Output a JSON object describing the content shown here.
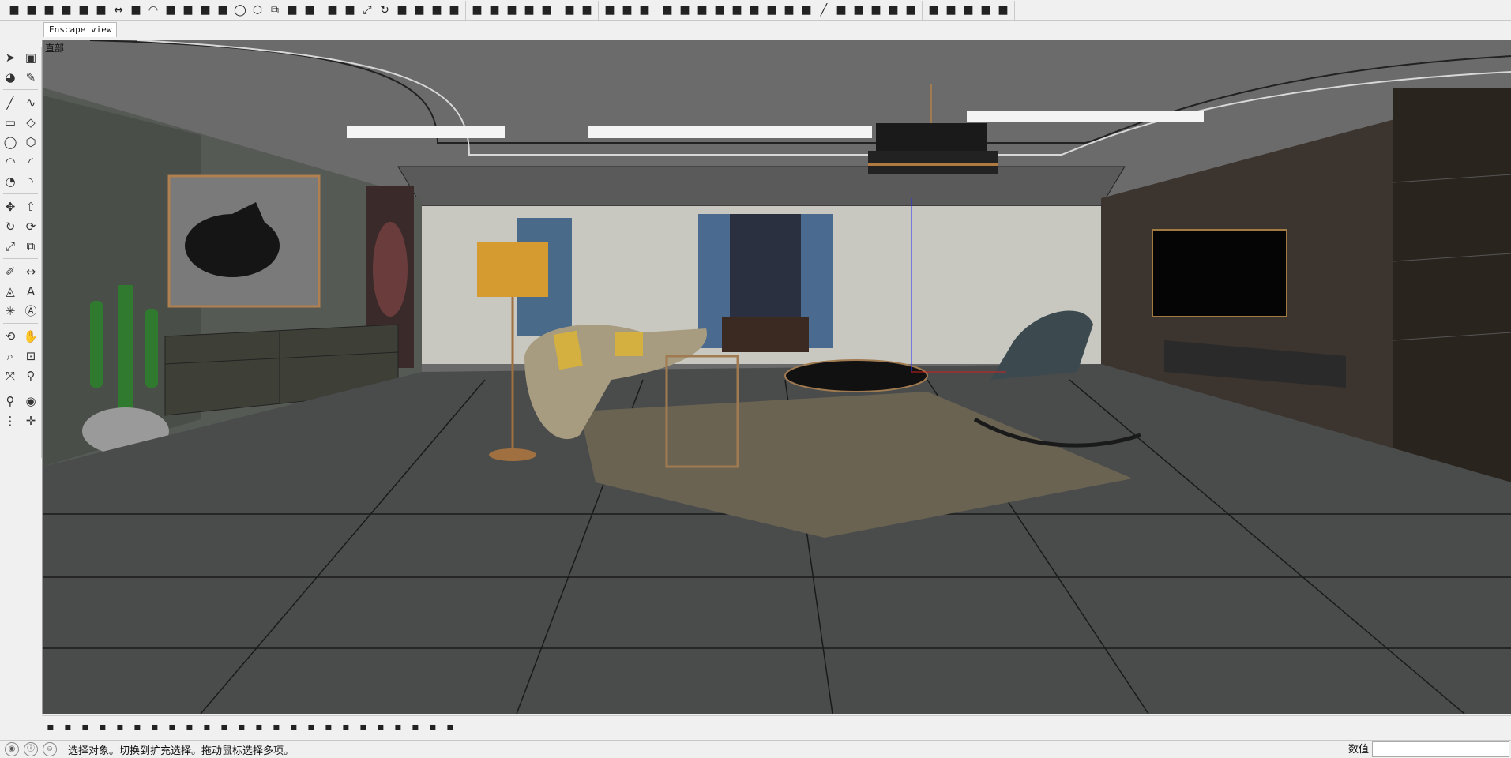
{
  "tab": {
    "label": "Enscape view"
  },
  "viewport": {
    "label": "直部"
  },
  "status": {
    "message": "选择对象。切换到扩充选择。拖动鼠标选择多项。",
    "measure_label": "数值",
    "measure_value": ""
  },
  "top_toolbar": {
    "groups": [
      [
        "layers-icon",
        "table-icon",
        "curve-icon",
        "bars-icon",
        "plugin-icon",
        "ruler-icon",
        "dimension-icon",
        "pencil-icon",
        "arc-icon",
        "bezier-icon",
        "wave-icon",
        "spiral-icon",
        "rectangle-icon",
        "circle-icon",
        "polygon-icon",
        "offset-icon",
        "shape-icon",
        "grid-icon"
      ],
      [
        "push-icon",
        "follow-icon",
        "scale-icon",
        "rotate-icon",
        "flip-icon",
        "mirror-icon",
        "array-icon",
        "door-icon"
      ],
      [
        "triangle-icon",
        "dots-icon",
        "page-icon",
        "pen-icon",
        "brush-icon"
      ],
      [
        "camera-icon",
        "save-icon"
      ],
      [
        "press-icon",
        "check-icon",
        "connect-icon"
      ],
      [
        "leaf-icon",
        "shield-icon",
        "doc-icon",
        "star-icon",
        "target-icon",
        "flame-icon",
        "link-icon",
        "gauge-icon",
        "disc-icon",
        "line-icon",
        "cluster-icon",
        "gear-icon",
        "cloud-icon",
        "blade-icon",
        "spin-icon"
      ],
      [
        "expand-icon",
        "collapse-icon",
        "vortex-icon",
        "leafs-icon",
        "tag-icon"
      ]
    ]
  },
  "left_toolbar": {
    "rows": [
      [
        "select-icon",
        "component-icon"
      ],
      [
        "paint-icon",
        "eraser-icon"
      ],
      [
        "line-icon",
        "freehand-icon"
      ],
      [
        "rect-icon",
        "rotated-rect-icon"
      ],
      [
        "circle-icon",
        "polygon-icon"
      ],
      [
        "arc-icon",
        "arc2-icon"
      ],
      [
        "pie-icon",
        "arc3-icon"
      ],
      [
        "move-icon",
        "pushpull-icon"
      ],
      [
        "rotate-icon",
        "followme-icon"
      ],
      [
        "scale-icon",
        "offset-icon"
      ],
      [
        "tape-icon",
        "dimension-icon"
      ],
      [
        "protractor-icon",
        "text-icon"
      ],
      [
        "axes-icon",
        "3dtext-icon"
      ],
      [
        "orbit-icon",
        "pan-icon"
      ],
      [
        "zoom-icon",
        "zoom-window-icon"
      ],
      [
        "zoom-extents-icon",
        "search-icon"
      ],
      [
        "walk-icon",
        "look-icon"
      ],
      [
        "footprint-icon",
        "position-camera-icon"
      ]
    ]
  },
  "bottom_toolbar": {
    "items": [
      "render-start-icon",
      "refresh-icon",
      "asset-icon",
      "sync-icon",
      "capture-icon",
      "audio-icon",
      "settings-icon",
      "shield-gold-icon",
      "gear-blue-icon",
      "sliders-icon",
      "chat-icon",
      "badge-icon",
      "list-icon",
      "page-icon",
      "views-icon",
      "views2-icon",
      "views3-icon",
      "views4-icon",
      "views5-icon",
      "views6-icon",
      "views7-icon",
      "panel-icon",
      "panel2-icon",
      "panel3-icon"
    ]
  }
}
